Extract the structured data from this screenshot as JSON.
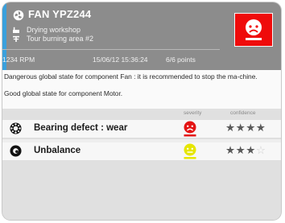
{
  "header": {
    "title": "FAN YPZ244",
    "location_1": "Drying workshop",
    "location_2": "Tour burning area #2",
    "rpm": "1234 RPM",
    "timestamp": "15/06/12 15:36:24",
    "points": "6/6 points",
    "accent_color": "#3aa0dc",
    "alert_color": "#ef0b0b"
  },
  "message": {
    "line_1": "Dangerous global state for component Fan : it is recommended to stop the ma-chine.",
    "line_2": "Good global state for component Motor."
  },
  "columns": {
    "severity": "severity",
    "confidence": "confidence"
  },
  "defects": [
    {
      "label": "Bearing defect : wear",
      "icon": "bearing-icon",
      "severity_color": "#e41414",
      "severity_level": "critical",
      "confidence": 4,
      "confidence_max": 4
    },
    {
      "label": "Unbalance",
      "icon": "unbalance-icon",
      "severity_color": "#e6e600",
      "severity_level": "warning",
      "confidence": 3,
      "confidence_max": 4
    }
  ]
}
